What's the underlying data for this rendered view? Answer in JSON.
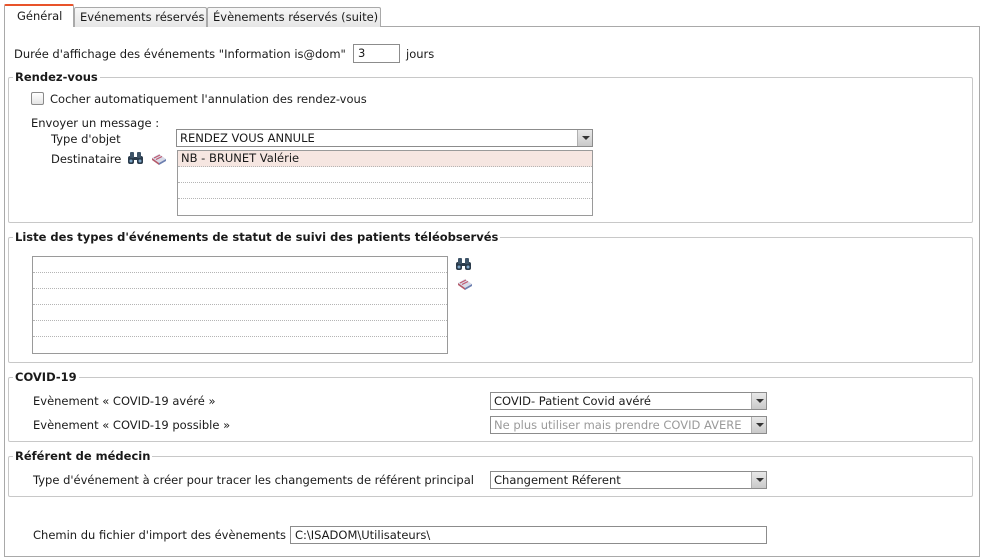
{
  "tabs": [
    {
      "label": "Général"
    },
    {
      "label": "Evénements réservés"
    },
    {
      "label": "Évènements réservés (suite)"
    }
  ],
  "display_duration": {
    "label": "Durée d'affichage des événements \"Information is@dom\"",
    "value": "3",
    "unit": "jours"
  },
  "rdv": {
    "legend": "Rendez-vous",
    "auto_cancel_label": "Cocher automatiquement l'annulation des rendez-vous",
    "auto_cancel_checked": false,
    "send_message_label": "Envoyer un message :",
    "object_type_label": "Type d'objet",
    "object_type_value": "RENDEZ VOUS ANNULE",
    "recipient_label": "Destinataire",
    "recipients": [
      "NB - BRUNET Valérie",
      "",
      "",
      ""
    ]
  },
  "tele": {
    "legend": "Liste des types d'événements de statut de suivi des patients téléobservés",
    "rows": [
      "",
      "",
      "",
      "",
      "",
      ""
    ]
  },
  "covid": {
    "legend": "COVID-19",
    "confirmed_label": "Evènement « COVID-19 avéré »",
    "confirmed_value": "COVID- Patient Covid avéré",
    "possible_label": "Evènement « COVID-19 possible »",
    "possible_value": "Ne plus utiliser mais prendre COVID AVERE"
  },
  "referent": {
    "legend": "Référent de médecin",
    "label": "Type d'événement à créer pour tracer les changements de référent principal",
    "value": "Changement Réferent"
  },
  "import_path": {
    "label": "Chemin du fichier d'import des évènements",
    "value": "C:\\ISADOM\\Utilisateurs\\"
  },
  "colors": {
    "active_tab_accent": "#e8532a",
    "selected_row": "#f6e6e1"
  }
}
